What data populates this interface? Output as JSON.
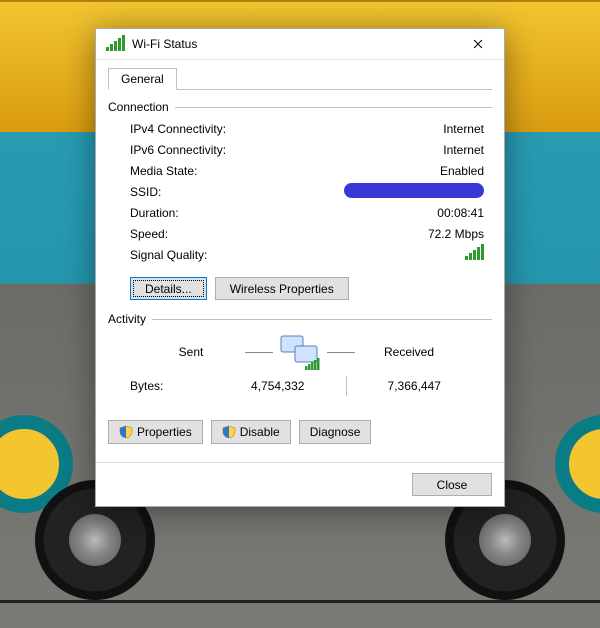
{
  "window": {
    "title": "Wi-Fi Status"
  },
  "tabs": {
    "general": "General"
  },
  "connection": {
    "header": "Connection",
    "ipv4_label": "IPv4 Connectivity:",
    "ipv4_value": "Internet",
    "ipv6_label": "IPv6 Connectivity:",
    "ipv6_value": "Internet",
    "media_label": "Media State:",
    "media_value": "Enabled",
    "ssid_label": "SSID:",
    "duration_label": "Duration:",
    "duration_value": "00:08:41",
    "speed_label": "Speed:",
    "speed_value": "72.2 Mbps",
    "signal_label": "Signal Quality:"
  },
  "buttons": {
    "details": "Details...",
    "wireless_properties": "Wireless Properties",
    "properties": "Properties",
    "disable": "Disable",
    "diagnose": "Diagnose",
    "close": "Close"
  },
  "activity": {
    "header": "Activity",
    "sent_label": "Sent",
    "received_label": "Received",
    "bytes_label": "Bytes:",
    "sent_value": "4,754,332",
    "received_value": "7,366,447"
  }
}
